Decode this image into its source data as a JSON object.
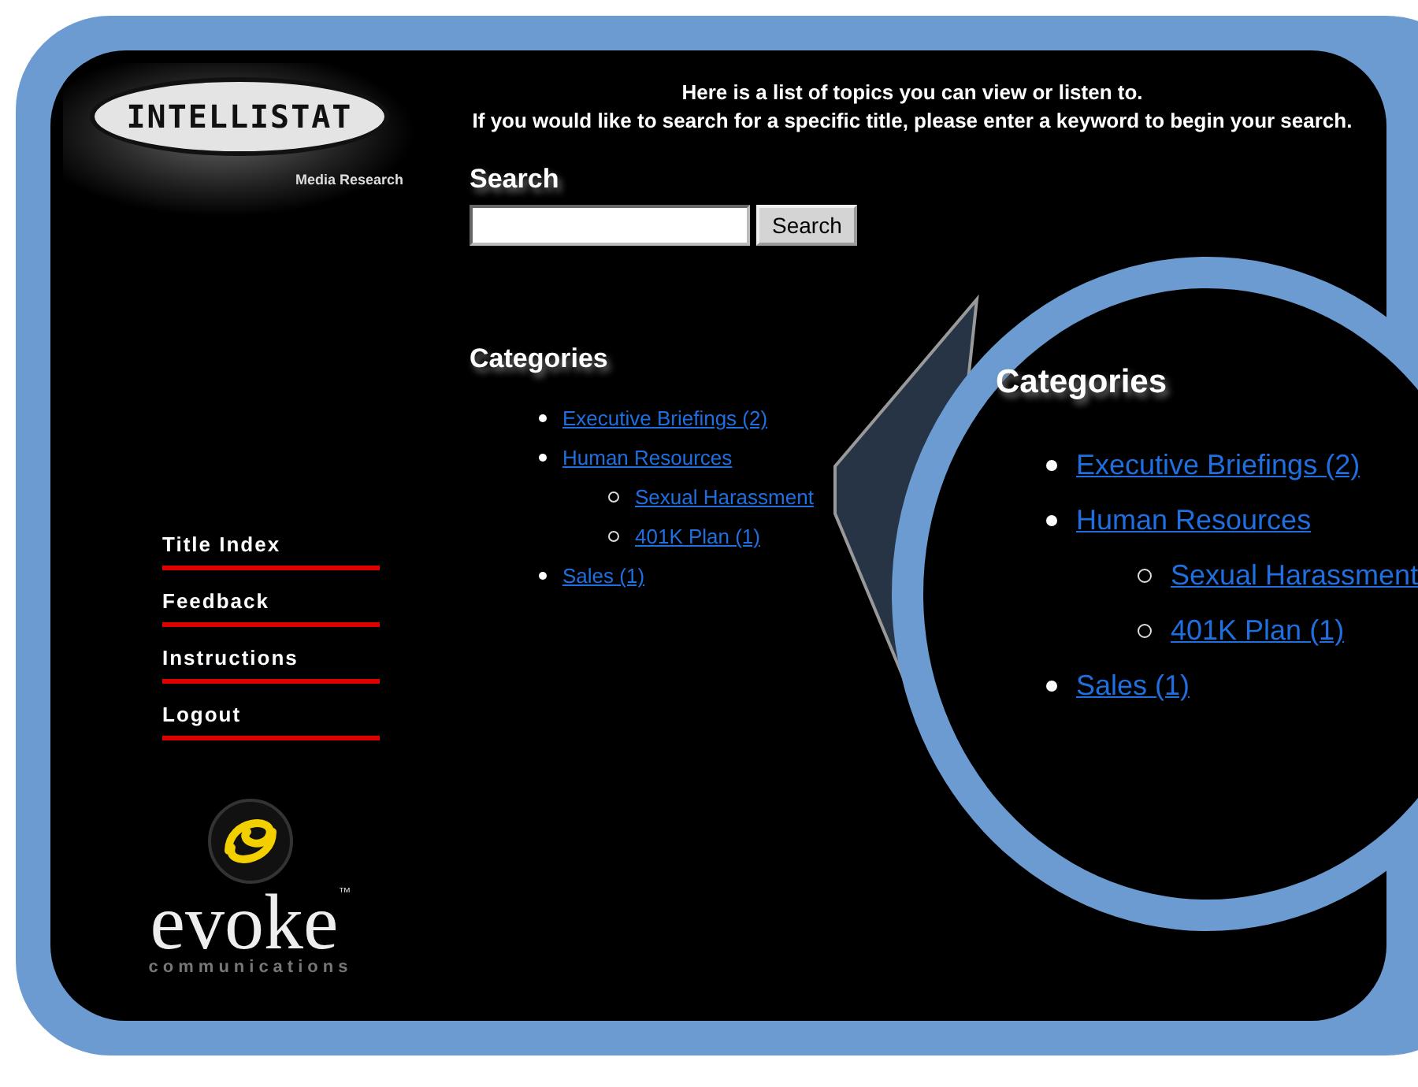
{
  "logo": {
    "name": "INTELLISTAT",
    "tagline": "Media Research"
  },
  "intro": [
    "Here is a list of topics you can view or listen to.",
    "If you would like to search for a specific title, please enter a keyword to begin your search."
  ],
  "search": {
    "heading": "Search",
    "button": "Search"
  },
  "categories": {
    "heading": "Categories",
    "items": [
      {
        "label": "Executive Briefings (2)"
      },
      {
        "label": "Human Resources",
        "children": [
          {
            "label": "Sexual Harassment"
          },
          {
            "label": "401K Plan (1)"
          }
        ]
      },
      {
        "label": "Sales (1)"
      }
    ]
  },
  "nav": [
    "Title Index",
    "Feedback",
    "Instructions",
    "Logout"
  ],
  "partner_logo": {
    "name": "evoke",
    "mark": "™",
    "tagline": "communications"
  },
  "magnifier": {
    "heading": "Categories",
    "items": [
      {
        "label": "Executive Briefings (2)"
      },
      {
        "label": "Human Resources",
        "children": [
          {
            "label": "Sexual Harassment"
          },
          {
            "label": "401K Plan (1)"
          }
        ]
      },
      {
        "label": "Sales (1)"
      }
    ]
  }
}
